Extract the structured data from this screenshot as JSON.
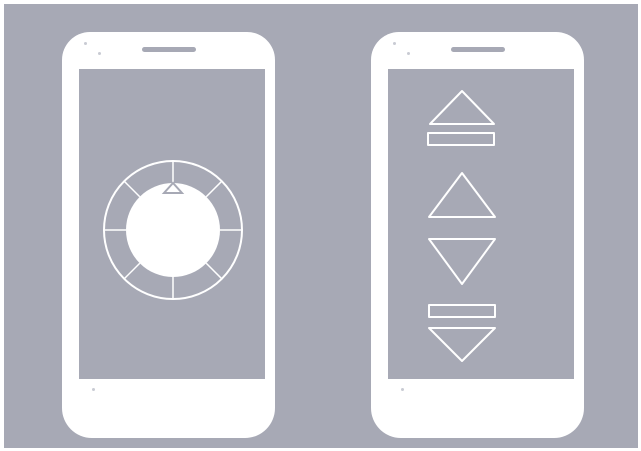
{
  "scene": {
    "background_color": "#a7a9b5",
    "phone_color": "#ffffff",
    "outline_color": "#ffffff"
  },
  "left_phone": {
    "control": "rotary-dial",
    "dial_segments": 8,
    "indicator_icon": "triangle-up-icon"
  },
  "right_phone": {
    "controls": [
      {
        "name": "move-to-top-button",
        "icon": "triangle-up-with-bar-icon"
      },
      {
        "name": "move-up-button",
        "icon": "triangle-up-icon"
      },
      {
        "name": "move-down-button",
        "icon": "triangle-down-icon"
      },
      {
        "name": "move-to-bottom-button",
        "icon": "bar-with-triangle-down-icon"
      }
    ]
  }
}
